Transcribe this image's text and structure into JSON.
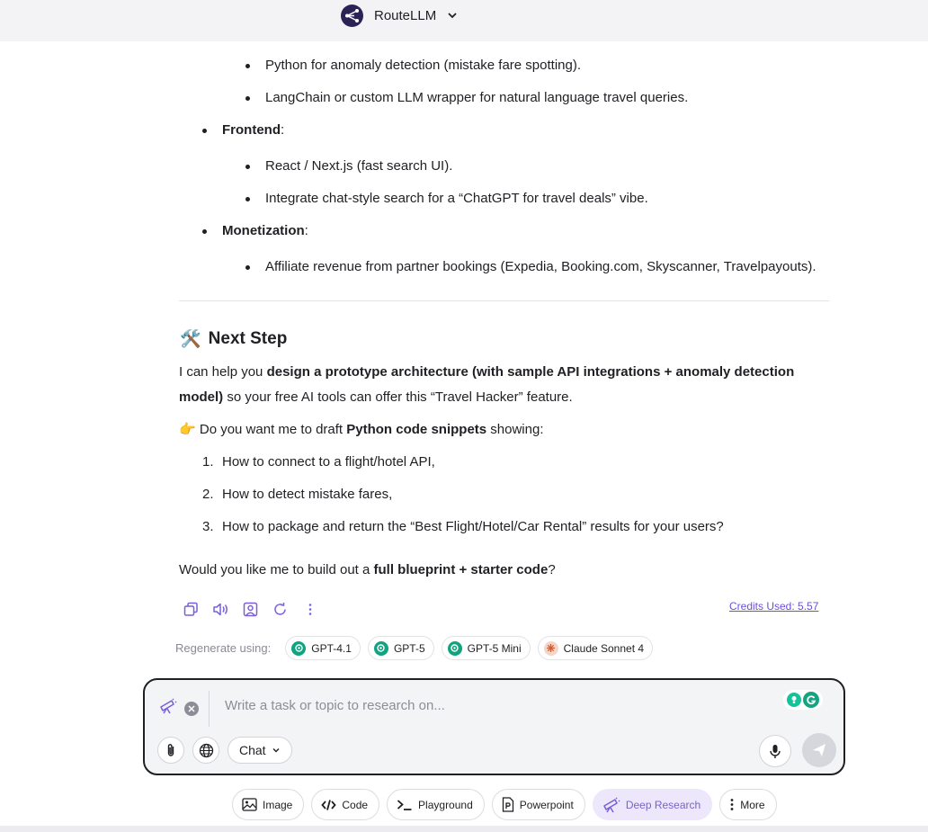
{
  "header": {
    "app_name": "RouteLLM"
  },
  "message": {
    "backend_sub": [
      "Python for anomaly detection (mistake fare spotting).",
      "LangChain or custom LLM wrapper for natural language travel queries."
    ],
    "frontend": {
      "label": "Frontend",
      "suffix": ":",
      "items": [
        "React / Next.js (fast search UI).",
        "Integrate chat-style search for a “ChatGPT for travel deals” vibe."
      ]
    },
    "monetization": {
      "label": "Monetization",
      "suffix": ":",
      "items": [
        "Affiliate revenue from partner bookings (Expedia, Booking.com, Skyscanner, Travelpayouts)."
      ]
    },
    "next_step": {
      "emoji": "🛠️",
      "title": "Next Step",
      "p1_a": "I can help you ",
      "p1_b": "design a prototype architecture (with sample API integrations + anomaly detection model)",
      "p1_c": " so your free AI tools can offer this “Travel Hacker” feature.",
      "p2_emoji": "👉",
      "p2_a": " Do you want me to draft ",
      "p2_b": "Python code snippets",
      "p2_c": " showing:",
      "list": [
        {
          "n": "1.",
          "text": "How to connect to a flight/hotel API,"
        },
        {
          "n": "2.",
          "text": "How to detect mistake fares,"
        },
        {
          "n": "3.",
          "text": "How to package and return the “Best Flight/Hotel/Car Rental” results for your users?"
        }
      ],
      "p3_a": "Would you like me to build out a ",
      "p3_b": "full blueprint + starter code",
      "p3_c": "?"
    }
  },
  "actions": {
    "credits": "Credits Used: 5.57",
    "icons": [
      "copy-icon",
      "speaker-icon",
      "person-icon",
      "refresh-icon",
      "more-vertical-icon"
    ]
  },
  "regenerate": {
    "label": "Regenerate using:",
    "models": [
      {
        "name": "GPT-4.1",
        "color": "#10a37f"
      },
      {
        "name": "GPT-5",
        "color": "#10a37f"
      },
      {
        "name": "GPT-5 Mini",
        "color": "#10a37f"
      },
      {
        "name": "Claude Sonnet 4",
        "color": "#d97757"
      }
    ]
  },
  "composer": {
    "placeholder": "Write a task or topic to research on...",
    "mode": "Chat"
  },
  "tools": [
    {
      "label": "Image",
      "icon": "image-icon"
    },
    {
      "label": "Code",
      "icon": "code-icon"
    },
    {
      "label": "Playground",
      "icon": "terminal-icon"
    },
    {
      "label": "Powerpoint",
      "icon": "powerpoint-icon"
    },
    {
      "label": "Deep Research",
      "icon": "telescope-icon",
      "active": true
    },
    {
      "label": "More",
      "icon": "more-vertical-icon"
    }
  ],
  "colors": {
    "accent": "#7a5fd8",
    "text": "#1f1f24"
  }
}
